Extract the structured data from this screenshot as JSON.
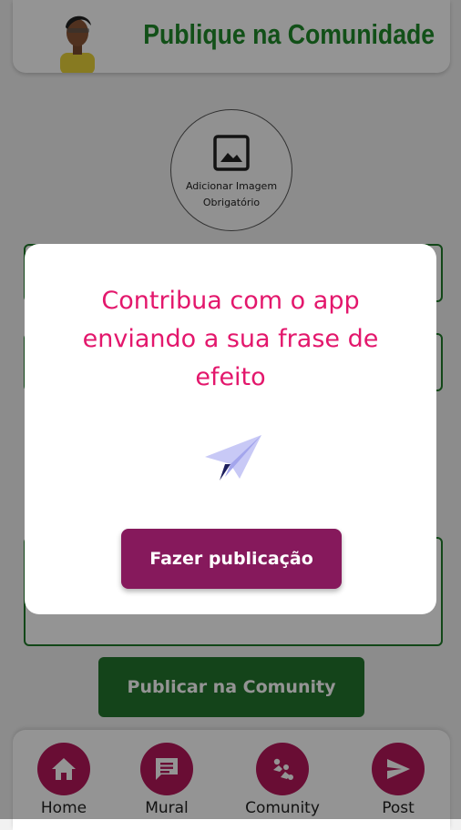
{
  "header": {
    "title": "Publique na Comunidade"
  },
  "image_picker": {
    "line1": "Adicionar Imagem",
    "line2": "Obrigatório"
  },
  "publish_button": {
    "label": "Publicar na Comunity"
  },
  "bottom_nav": [
    {
      "label": "Home",
      "icon": "home-icon"
    },
    {
      "label": "Mural",
      "icon": "chat-icon"
    },
    {
      "label": "Comunity",
      "icon": "community-icon"
    },
    {
      "label": "Post",
      "icon": "send-icon"
    }
  ],
  "modal": {
    "message": "Contribua com o app enviando a sua frase de efeito",
    "button": "Fazer publicação",
    "icon": "paper-plane-icon"
  },
  "colors": {
    "header_title": "#1f8a2a",
    "modal_text": "#e3176c",
    "modal_button": "#86195c",
    "nav_accent": "#b5175a",
    "publish_button": "#23762e"
  }
}
